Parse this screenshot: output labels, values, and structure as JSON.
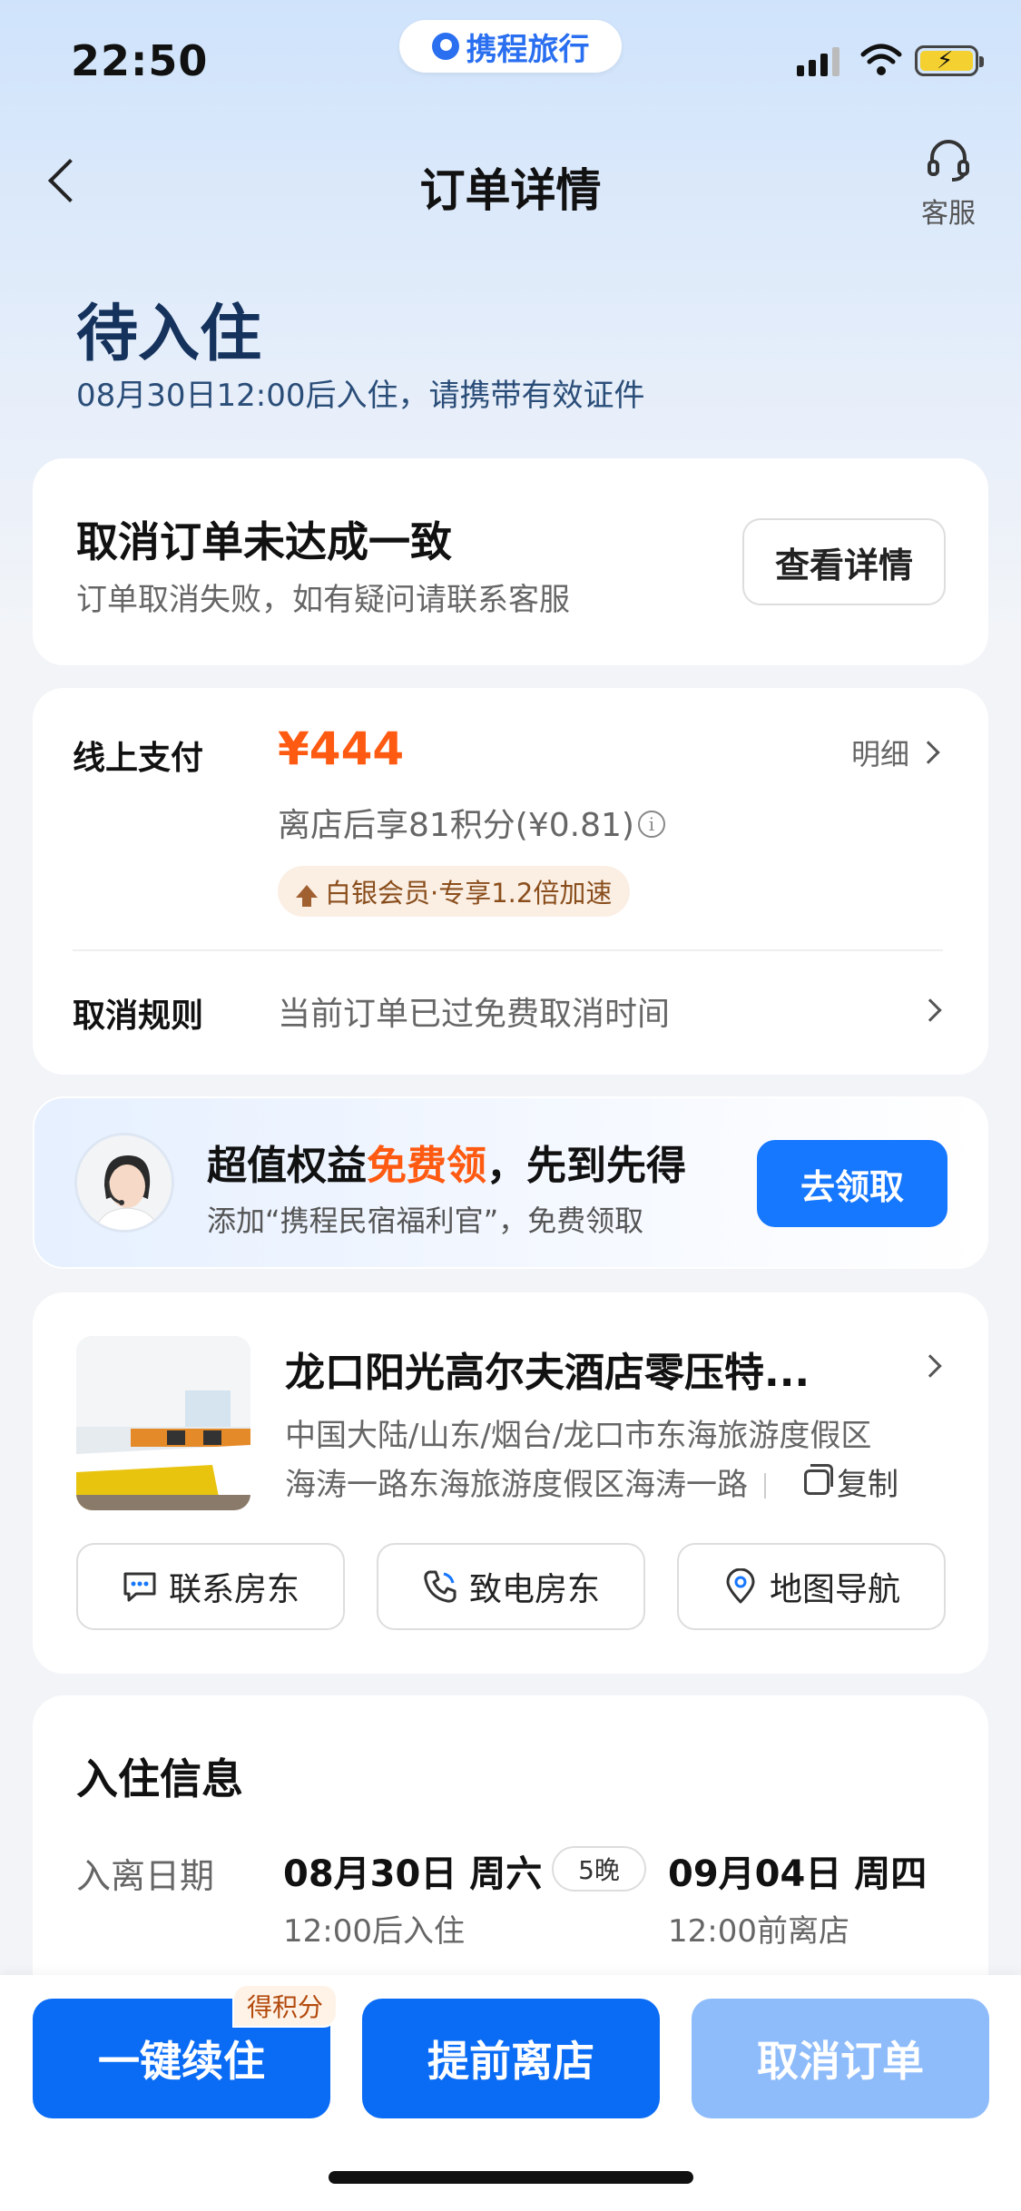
{
  "status_bar": {
    "time": "22:50",
    "brand": "携程旅行"
  },
  "nav": {
    "title": "订单详情",
    "service_label": "客服"
  },
  "order_status": {
    "title": "待入住",
    "subtitle": "08月30日12:00后入住，请携带有效证件"
  },
  "cancel_notice": {
    "title": "取消订单未达成一致",
    "subtitle": "订单取消失败，如有疑问请联系客服",
    "button": "查看详情"
  },
  "payment": {
    "label": "线上支付",
    "price": "¥444",
    "detail_link": "明细",
    "points": "离店后享81积分(¥0.81)",
    "member_badge": "白银会员·专享1.2倍加速",
    "cancel_rule_label": "取消规则",
    "cancel_rule_value": "当前订单已过免费取消时间"
  },
  "promo": {
    "title_a": "超值权益",
    "title_highlight": "免费领",
    "title_b": "，先到先得",
    "subtitle": "添加“携程民宿福利官”，免费领取",
    "button": "去领取"
  },
  "hotel": {
    "name": "龙口阳光高尔夫酒店零压特...",
    "address_line1": "中国大陆/山东/烟台/龙口市东海旅游度假区",
    "address_line2": "海涛一路东海旅游度假区海涛一路",
    "copy_label": "复制",
    "actions": [
      {
        "label": "联系房东",
        "icon": "chat-icon"
      },
      {
        "label": "致电房东",
        "icon": "phone-icon"
      },
      {
        "label": "地图导航",
        "icon": "location-pin-icon"
      }
    ]
  },
  "checkin": {
    "title": "入住信息",
    "date_label": "入离日期",
    "checkin_date": "08月30日 周六",
    "nights": "5晚",
    "checkout_date": "09月04日 周四",
    "checkin_time": "12:00后入住",
    "checkout_time": "12:00前离店"
  },
  "bottom": {
    "extend_label": "一键续住",
    "points_tag": "得积分",
    "early_checkout_label": "提前离店",
    "cancel_label": "取消订单"
  },
  "colors": {
    "accent": "#1677ff",
    "price": "#ff5a12",
    "disabled": "#8ebcfb"
  }
}
